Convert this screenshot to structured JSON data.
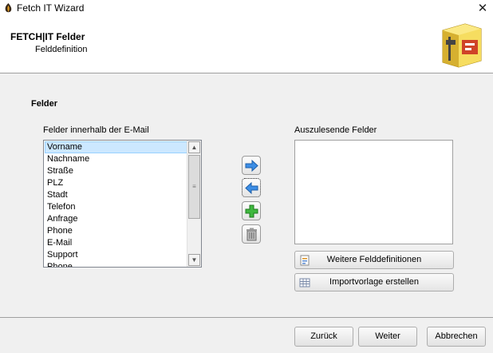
{
  "window": {
    "title": "Fetch IT Wizard"
  },
  "header": {
    "title": "FETCH|IT Felder",
    "subtitle": "Felddefinition"
  },
  "section": {
    "title": "Felder"
  },
  "source_list": {
    "label": "Felder innerhalb der E-Mail",
    "items": [
      "Vorname",
      "Nachname",
      "Straße",
      "PLZ",
      "Stadt",
      "Telefon",
      "Anfrage",
      "Phone",
      "E-Mail",
      "Support",
      "Phone"
    ]
  },
  "target_list": {
    "label": "Auszulesende Felder",
    "items": []
  },
  "actions": {
    "more_fields": "Weitere Felddefinitionen",
    "import_template": "Importvorlage erstellen"
  },
  "nav": {
    "back": "Zurück",
    "next": "Weiter",
    "cancel": "Abbrechen"
  }
}
